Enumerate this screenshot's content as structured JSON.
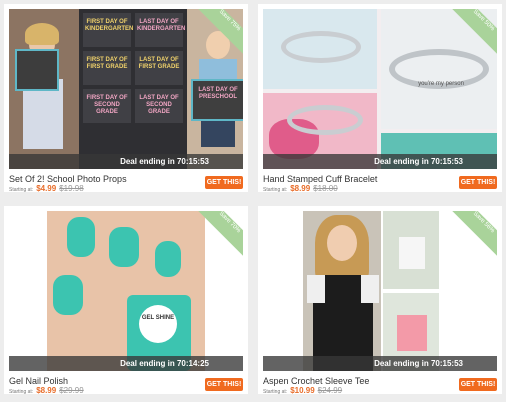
{
  "products": [
    {
      "title": "Set Of 2! School Photo Props",
      "starting_label": "Starting at:",
      "price": "$4.99",
      "original_price": "$19.98",
      "deal_text": "Deal ending in 70:15:53",
      "ribbon_text": "Save 75%",
      "button_label": "GET THIS!",
      "sign_texts": [
        "FIRST DAY OF KINDERGARTEN",
        "LAST DAY OF KINDERGARTEN",
        "FIRST DAY OF FIRST GRADE",
        "LAST DAY OF FIRST GRADE",
        "FIRST DAY OF SECOND GRADE",
        "LAST DAY OF SECOND GRADE",
        "LAST DAY OF PRESCHOOL"
      ]
    },
    {
      "title": "Hand Stamped Cuff Bracelet",
      "starting_label": "Starting at:",
      "price": "$8.99",
      "original_price": "$18.00",
      "deal_text": "Deal ending in 70:15:53",
      "ribbon_text": "Save 50%",
      "button_label": "GET THIS!",
      "engravings": [
        "you're my person"
      ]
    },
    {
      "title": "Gel Nail Polish",
      "starting_label": "Starting at:",
      "price": "$8.99",
      "original_price": "$29.99",
      "deal_text": "Deal ending in 70:14:25",
      "ribbon_text": "Save 70%",
      "button_label": "GET THIS!",
      "bottle_texts": [
        "GEL SHINE"
      ]
    },
    {
      "title": "Aspen Crochet Sleeve Tee",
      "starting_label": "Starting at:",
      "price": "$10.99",
      "original_price": "$24.99",
      "deal_text": "Deal ending in 70:15:53",
      "ribbon_text": "Save 56%",
      "button_label": "GET THIS!"
    }
  ],
  "colors": {
    "accent": "#f06a1f",
    "price": "#e86d2a",
    "ribbon": "#a9d39a",
    "polish": "#3cc4b0"
  }
}
